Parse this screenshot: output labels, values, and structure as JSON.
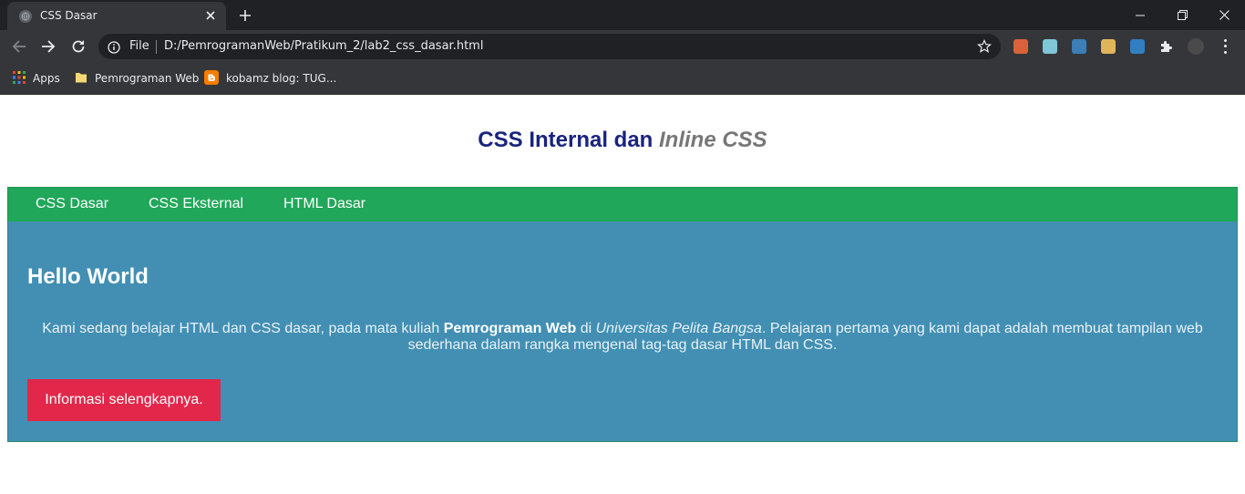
{
  "browser": {
    "tab_title": "CSS Dasar",
    "address_scheme": "File",
    "address_url": "D:/PemrogramanWeb/Pratikum_2/lab2_css_dasar.html",
    "bookmarks": [
      {
        "label": "Apps",
        "icon": "apps-grid-icon"
      },
      {
        "label": "Pemrograman Web",
        "icon": "folder-icon"
      },
      {
        "label": "kobamz blog: TUG...",
        "icon": "blogger-icon"
      }
    ],
    "extension_colors": [
      "#d9623b",
      "#7ec6d8",
      "#3c7eb5",
      "#e0b55a",
      "#2f7fc1",
      "#bdbdbd",
      "#4a4a4a"
    ]
  },
  "page": {
    "header_plain": "CSS Internal dan ",
    "header_italic": "Inline",
    "header_italic_css": " CSS",
    "nav": [
      "CSS Dasar",
      "CSS Eksternal",
      "HTML Dasar"
    ],
    "hero": {
      "title": "Hello World",
      "text_1": "Kami sedang belajar HTML dan CSS dasar, pada mata kuliah ",
      "text_bold": "Pemrograman Web",
      "text_2": " di ",
      "text_italic": "Universitas Pelita Bangsa",
      "text_3": ". Pelajaran pertama yang kami dapat adalah membuat tampilan web sederhana dalam rangka mengenal tag-tag dasar HTML dan CSS.",
      "button": "Informasi selengkapnya."
    },
    "colors": {
      "header": "#1a237e",
      "nav_bg": "#20a759",
      "hero_bg": "#428fb3",
      "button_bg": "#e2274a"
    }
  }
}
